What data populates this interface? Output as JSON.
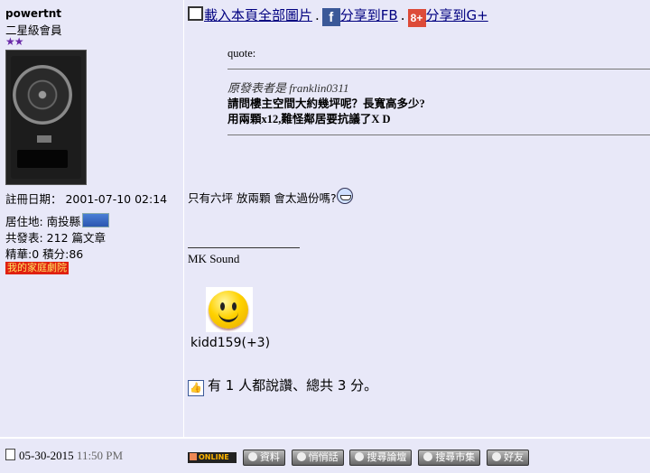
{
  "author": {
    "username": "powertnt",
    "rank": "二星級會員",
    "stars": "★★",
    "registered": "註冊日期： 2001-07-10 02:14",
    "location": "居住地: 南投縣",
    "posts": "共發表: 212 篇文章",
    "essence": "精華:0 積分:86",
    "theater_link": "我的家庭劇院"
  },
  "share": {
    "load_images": "載入本頁全部圖片",
    "separator": ".",
    "share_fb": "分享到FB",
    "share_gplus": "分享到G+",
    "fb_icon": "f",
    "gplus_icon": "8+"
  },
  "quote": {
    "label": "quote:",
    "from": "原發表者是 franklin0311",
    "line1": "請問樓主空間大約幾坪呢？長寬高多少?",
    "line2": "用兩顆x12,難怪鄰居要抗議了X D"
  },
  "message": "只有六坪 放兩顆 會太過份嗎?",
  "signature": "MK Sound",
  "likers": "kidd159(+3)",
  "likes_summary": "有 1 人都說讚、總共 3 分。",
  "footer": {
    "date": "05-30-2015",
    "time": "11:50 PM",
    "online": "ONLINE",
    "buttons": [
      "資料",
      "悄悄話",
      "搜尋論壇",
      "搜尋市集",
      "好友"
    ]
  }
}
